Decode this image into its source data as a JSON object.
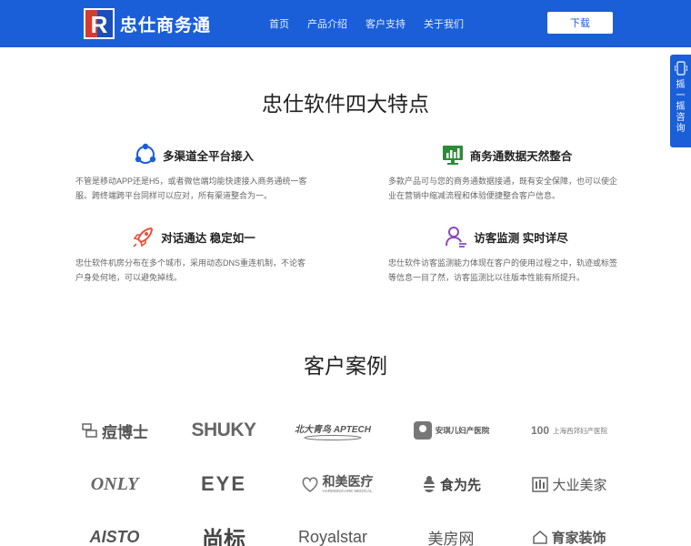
{
  "header": {
    "brand": "忠仕商务通",
    "nav": [
      "首页",
      "产品介绍",
      "客户支持",
      "关于我们"
    ],
    "download_label": "下载"
  },
  "side_float": {
    "label": "摇一摇咨询"
  },
  "features_section": {
    "title": "忠仕软件四大特点",
    "items": [
      {
        "title": "多渠道全平台接入",
        "icon": "share-nodes-icon",
        "desc": "不管是移动APP还是H5，或者微信端均能快速接入商务通统一客服。跨终端跨平台同样可以应对，所有渠道整合为一。"
      },
      {
        "title": "商务通数据天然整合",
        "icon": "monitor-chart-icon",
        "desc": "多款产品可与您的商务通数据接通，既有安全保障，也可以使企业在营销中缩减流程和体验便捷整合客户信息。"
      },
      {
        "title": "对话通达 稳定如一",
        "icon": "rocket-icon",
        "desc": "忠仕软件机房分布在多个城市，采用动态DNS重连机制，不论客户身处何地，可以避免掉线。"
      },
      {
        "title": "访客监测 实时详尽",
        "icon": "visitor-icon",
        "desc": "忠仕软件访客监测能力体现在客户的使用过程之中，轨迹或标签等信息一目了然，访客监测比以往版本性能有所提升。"
      }
    ]
  },
  "clients_section": {
    "title": "客户案例",
    "logos": [
      "痘博士",
      "SHUKY",
      "北大青鸟 APTECH",
      "安琪儿妇产医院",
      "上海西郊妇产医院",
      "100",
      "ONLY",
      "EYE",
      "和美医疗",
      "HARMONICARE MEDICAL",
      "食为先",
      "大业美家",
      "AISTO",
      "尚标",
      "Royalstar",
      "美房网",
      "育家装饰"
    ]
  }
}
